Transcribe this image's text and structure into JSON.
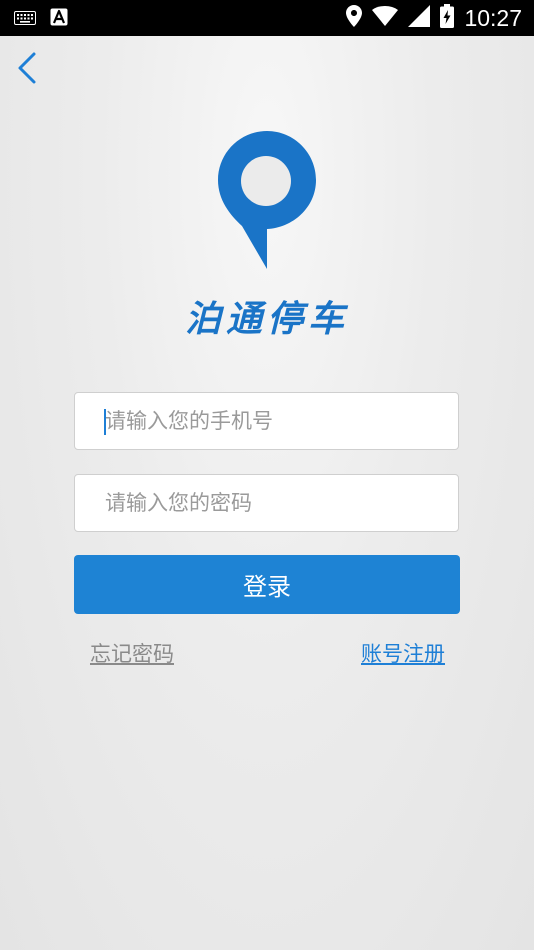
{
  "status_bar": {
    "time": "10:27",
    "icons": [
      "keyboard-icon",
      "a-notification-icon",
      "location-icon",
      "wifi-icon",
      "signal-icon",
      "battery-charging-icon"
    ]
  },
  "nav": {
    "back_icon": "chevron-left-icon"
  },
  "brand": {
    "app_name": "泊通停车",
    "logo_icon": "location-pin-logo-icon",
    "brand_color": "#1a74c7"
  },
  "form": {
    "phone_placeholder": "请输入您的手机号",
    "phone_value": "",
    "password_placeholder": "请输入您的密码",
    "password_value": "",
    "login_label": "登录",
    "login_color": "#1e83d4"
  },
  "links": {
    "forgot_password": "忘记密码",
    "register": "账号注册"
  }
}
